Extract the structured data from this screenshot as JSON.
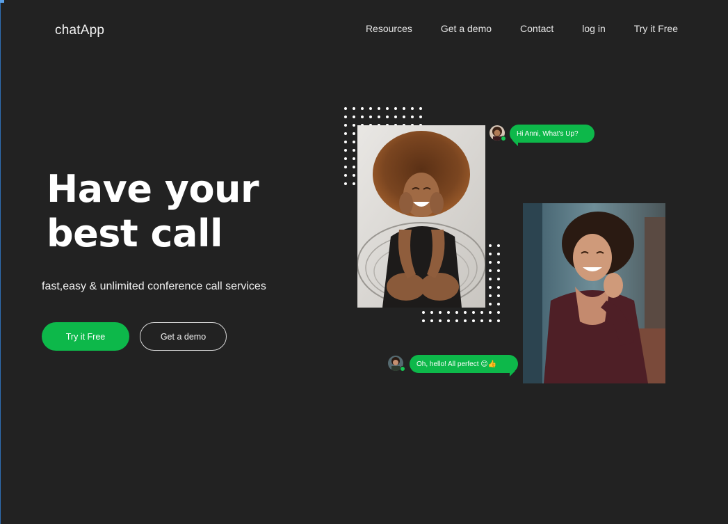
{
  "brand": {
    "name": "chatApp"
  },
  "nav": {
    "items": [
      "Resources",
      "Get a demo",
      "Contact",
      "log in",
      "Try it Free"
    ]
  },
  "hero": {
    "title_line1": "Have your",
    "title_line2": "best call",
    "subtitle": "fast,easy & unlimited conference call services",
    "primary_cta": "Try it Free",
    "secondary_cta": "Get a demo"
  },
  "chat": {
    "message1": "Hi Anni, What's Up?",
    "message2": "Oh, hello! All perfect 😊👍"
  },
  "colors": {
    "background": "#222222",
    "accent": "#0db84a",
    "text": "#ffffff"
  }
}
